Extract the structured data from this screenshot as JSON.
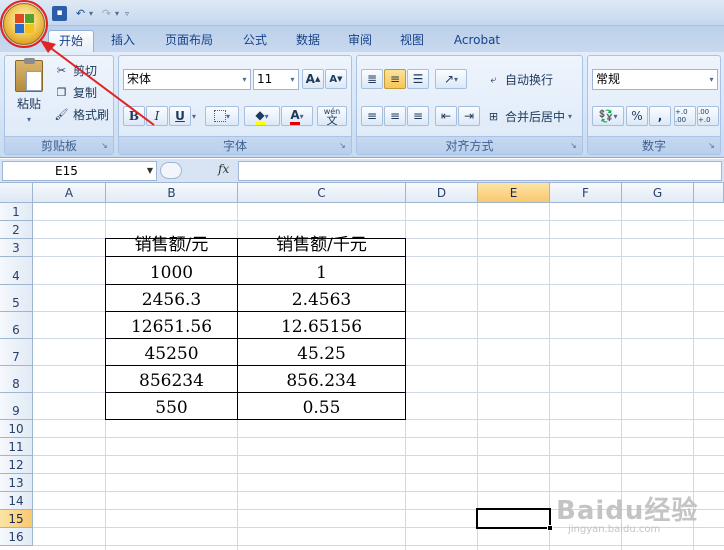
{
  "tabs": [
    "开始",
    "插入",
    "页面布局",
    "公式",
    "数据",
    "审阅",
    "视图",
    "Acrobat"
  ],
  "active_tab": 0,
  "clipboard": {
    "paste": "粘贴",
    "cut": "剪切",
    "copy": "复制",
    "format_painter": "格式刷",
    "title": "剪贴板"
  },
  "font": {
    "name": "宋体",
    "size": "11",
    "grow": "A",
    "shrink": "A",
    "bold": "B",
    "italic": "I",
    "underline": "U",
    "font_color_letter": "A",
    "wen": "wén",
    "wen_char": "文",
    "title": "字体"
  },
  "alignment": {
    "wrap_text": "自动换行",
    "merge_center": "合并后居中",
    "title": "对齐方式"
  },
  "number": {
    "format": "常规",
    "percent": "%",
    "comma": ",",
    "inc_decimal": "+.0 .00",
    "dec_decimal": ".00 +.0",
    "title": "数字"
  },
  "formula_bar": {
    "name_box": "E15",
    "fx": "fx",
    "value": ""
  },
  "columns": [
    "A",
    "B",
    "C",
    "D",
    "E",
    "F",
    "G"
  ],
  "selected_column": "E",
  "rows": [
    "1",
    "2",
    "3",
    "4",
    "5",
    "6",
    "7",
    "8",
    "9",
    "10",
    "11",
    "12",
    "13",
    "14",
    "15",
    "16"
  ],
  "selected_row": "15",
  "table": {
    "headers": [
      "销售额/元",
      "销售额/千元"
    ],
    "rows": [
      [
        "1000",
        "1"
      ],
      [
        "2456.3",
        "2.4563"
      ],
      [
        "12651.56",
        "12.65156"
      ],
      [
        "45250",
        "45.25"
      ],
      [
        "856234",
        "856.234"
      ],
      [
        "550",
        "0.55"
      ]
    ]
  },
  "watermark": {
    "main": "Baidu经验",
    "sub": "jingyan.baidu.com"
  },
  "colors": {
    "annotation_red": "#e32222",
    "selection_header": "#f9c870"
  }
}
